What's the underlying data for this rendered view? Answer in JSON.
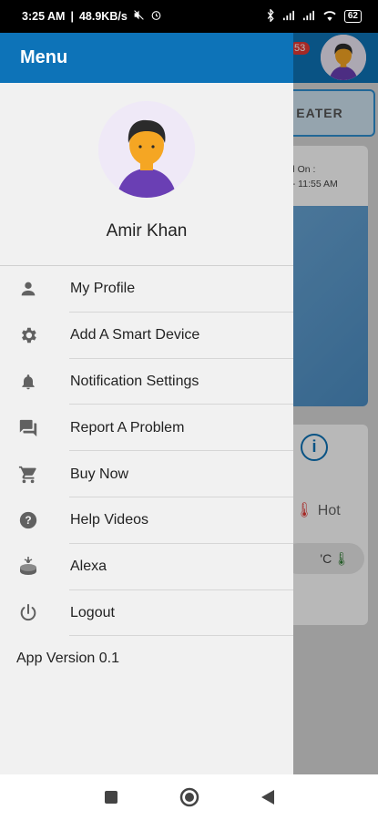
{
  "status_bar": {
    "time": "3:25 AM",
    "speed": "48.9KB/s",
    "battery": "62"
  },
  "background": {
    "notification_count": "53",
    "tab_label": "EATER",
    "card_line1": "ed On :",
    "card_line2": "1 - 11:55 AM",
    "info_icon": "i",
    "hot_label": "Hot",
    "pill_label": "'C"
  },
  "drawer": {
    "title": "Menu",
    "user_name": "Amir Khan",
    "items": [
      {
        "label": "My Profile",
        "icon": "person-icon"
      },
      {
        "label": "Add A Smart Device",
        "icon": "gear-icon"
      },
      {
        "label": "Notification Settings",
        "icon": "bell-icon"
      },
      {
        "label": "Report A Problem",
        "icon": "chat-icon"
      },
      {
        "label": "Buy Now",
        "icon": "cart-icon"
      },
      {
        "label": "Help Videos",
        "icon": "help-icon"
      },
      {
        "label": "Alexa",
        "icon": "alexa-icon"
      },
      {
        "label": "Logout",
        "icon": "power-icon"
      }
    ],
    "app_version": "App Version 0.1"
  },
  "colors": {
    "brand": "#0d73b8",
    "drawer_bg": "#f1f1f1",
    "avatar_bg": "#efe9f7"
  }
}
